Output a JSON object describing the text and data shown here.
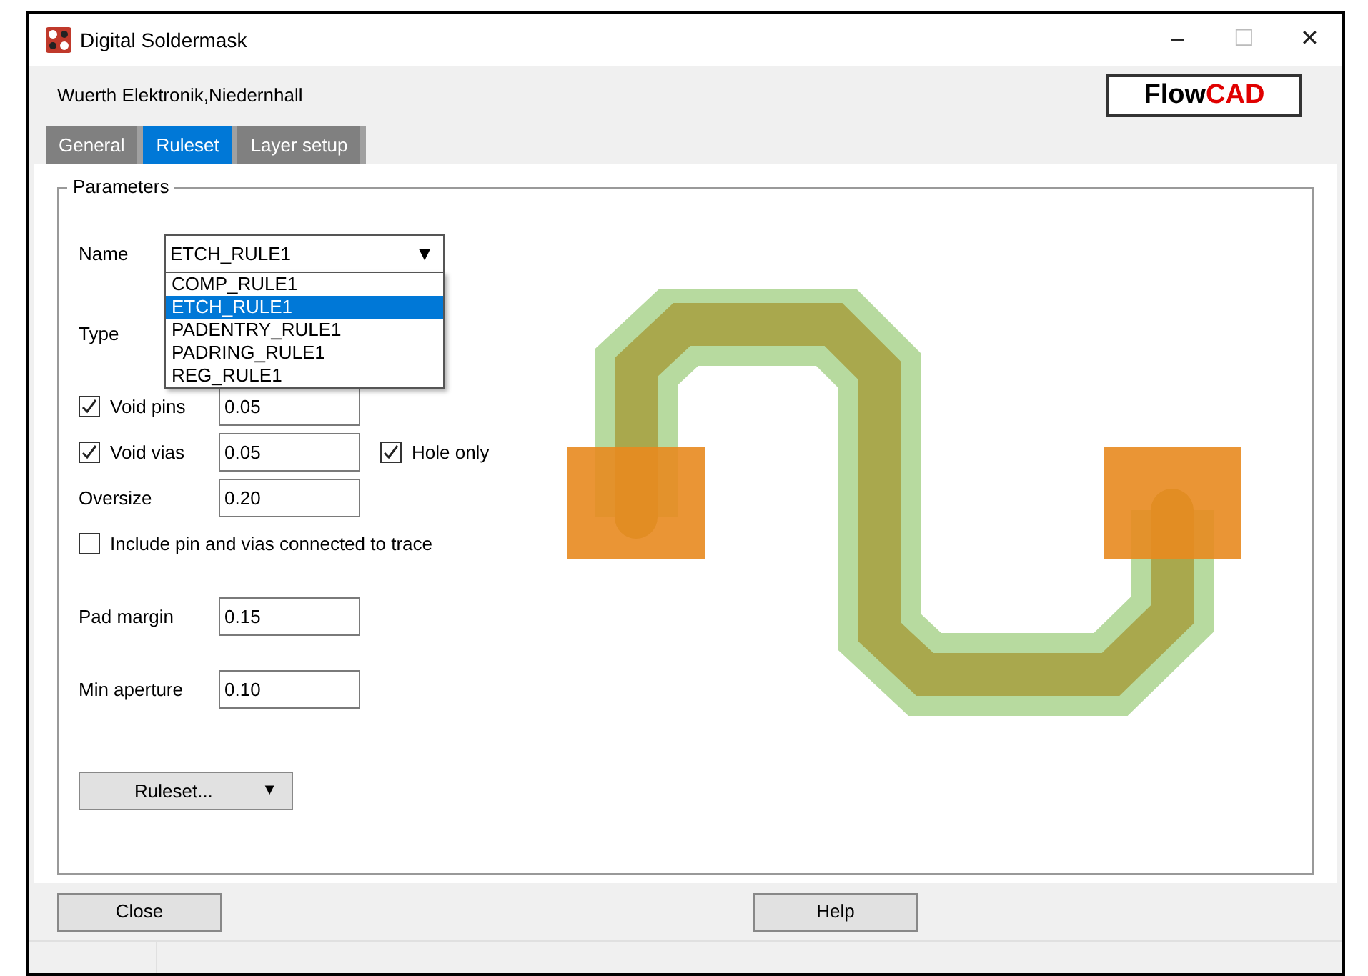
{
  "window": {
    "title": "Digital Soldermask",
    "controls": [
      "–",
      "☐",
      "✕"
    ]
  },
  "company": "Wuerth Elektronik,Niedernhall",
  "logo": {
    "part_1": "Flow",
    "part_2": "CAD"
  },
  "tabs": [
    {
      "label": "General",
      "selected": false
    },
    {
      "label": "Ruleset",
      "selected": true
    },
    {
      "label": "Layer setup",
      "selected": false
    }
  ],
  "parameters": {
    "title": "Parameters",
    "name": {
      "label": "Name",
      "value": "ETCH_RULE1",
      "arrow": "▼",
      "options": [
        {
          "label": "COMP_RULE1",
          "selected": false
        },
        {
          "label": "ETCH_RULE1",
          "selected": true
        },
        {
          "label": "PADENTRY_RULE1",
          "selected": false
        },
        {
          "label": "PADRING_RULE1",
          "selected": false
        },
        {
          "label": "REG_RULE1",
          "selected": false
        }
      ]
    },
    "type": {
      "label": "Type"
    },
    "rows": [
      {
        "kind": "check-field",
        "label": "Void pins",
        "checked": true,
        "value": "0.05"
      },
      {
        "kind": "check-field",
        "label": "Void vias",
        "checked": true,
        "value": "0.05",
        "extra": {
          "label": "Hole only",
          "checked": true
        }
      },
      {
        "kind": "field",
        "label": "Oversize",
        "value": "0.20"
      },
      {
        "kind": "check",
        "label": "Include pin and vias connected to trace",
        "checked": false
      },
      {
        "kind": "field",
        "label": "Pad margin",
        "value": "0.15"
      },
      {
        "kind": "field",
        "label": "Min aperture",
        "value": "0.10"
      }
    ],
    "ruleset_button": {
      "label": "Ruleset...",
      "arrow": "▼"
    }
  },
  "buttons": [
    "Close",
    "Help"
  ]
}
